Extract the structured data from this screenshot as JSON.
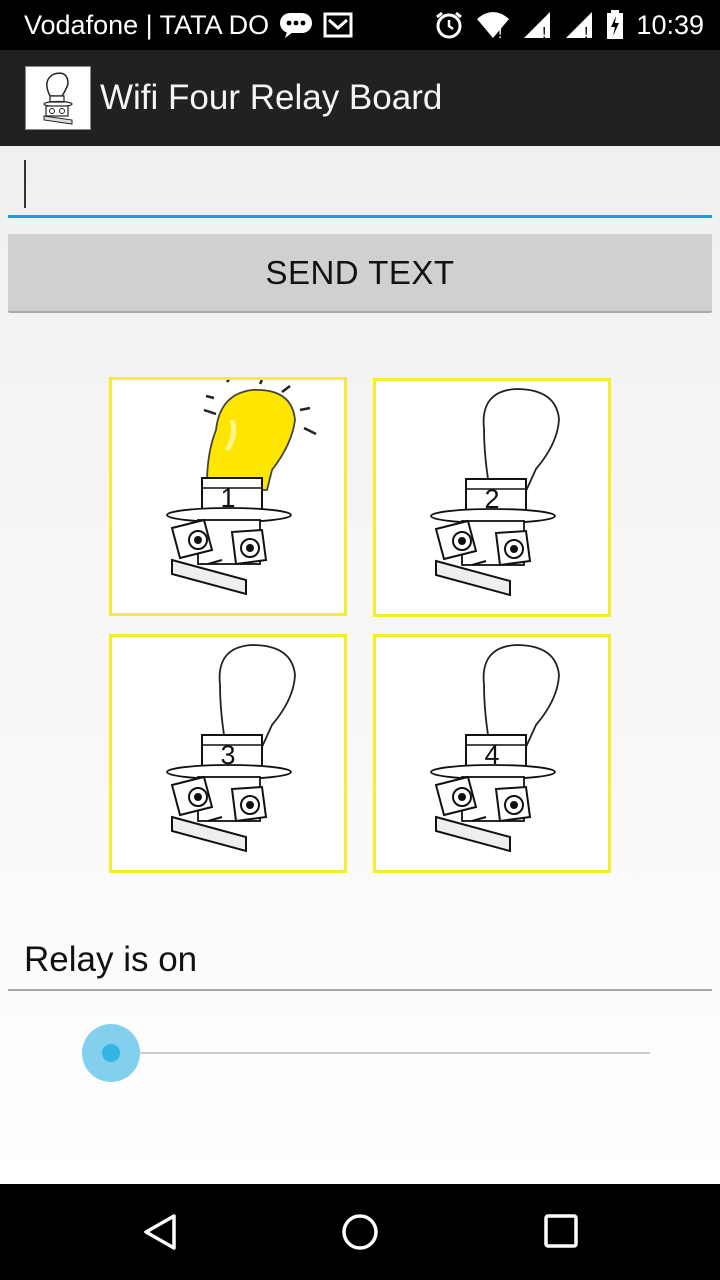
{
  "status_bar": {
    "carrier": "Vodafone | TATA DO",
    "time": "10:39",
    "icons": [
      "chat-icon",
      "mail-icon",
      "alarm-icon",
      "wifi-icon",
      "signal-icon",
      "signal-icon",
      "battery-charging-icon"
    ]
  },
  "app_bar": {
    "title": "Wifi Four Relay Board",
    "logo": "relay-bulb-logo"
  },
  "text_input": {
    "value": "",
    "accent": "#1a9fd8"
  },
  "send_button": {
    "label": "SEND TEXT"
  },
  "relays": [
    {
      "number": "1",
      "state": "on"
    },
    {
      "number": "2",
      "state": "off"
    },
    {
      "number": "3",
      "state": "off"
    },
    {
      "number": "4",
      "state": "off"
    }
  ],
  "relay_status": {
    "text": "Relay is on"
  },
  "slider": {
    "value": 0,
    "accent": "#33b5e5"
  },
  "nav_bar": {
    "buttons": [
      "back-icon",
      "home-icon",
      "recents-icon"
    ]
  },
  "colors": {
    "relay_border": "#f4ef2a",
    "bulb_on": "#ffe600"
  }
}
